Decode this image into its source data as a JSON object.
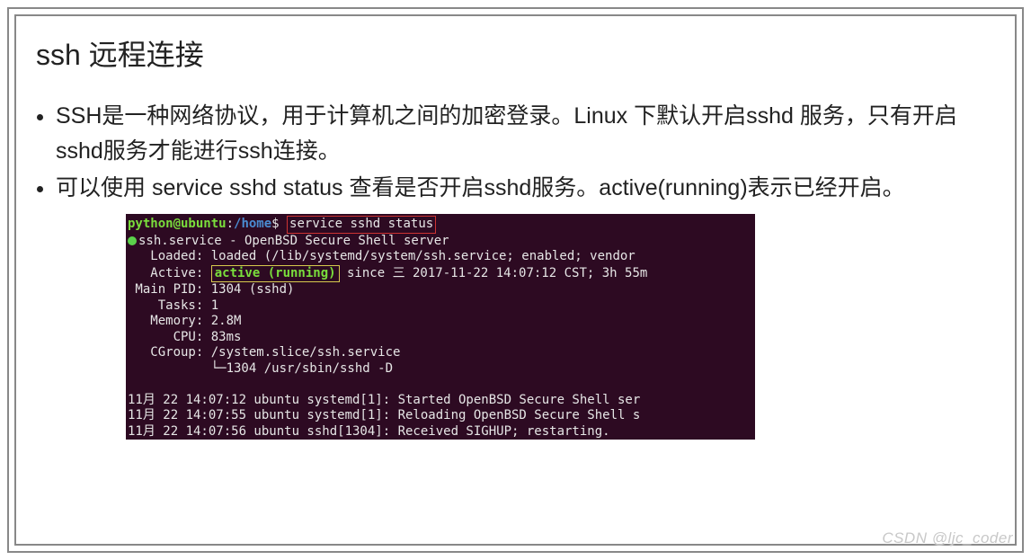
{
  "title": "ssh 远程连接",
  "bullets": [
    "SSH是一种网络协议，用于计算机之间的加密登录。Linux 下默认开启sshd 服务，只有开启sshd服务才能进行ssh连接。",
    "可以使用 service sshd status 查看是否开启sshd服务。active(running)表示已经开启。"
  ],
  "terminal": {
    "prompt_user": "python@ubuntu",
    "prompt_sep": ":",
    "prompt_path": "/home",
    "prompt_end": "$ ",
    "command": "service sshd status",
    "service_line": "ssh.service - OpenBSD Secure Shell server",
    "loaded": "   Loaded: loaded (/lib/systemd/system/ssh.service; enabled; vendor",
    "active_prefix": "   Active: ",
    "active_status": "active (running)",
    "active_suffix": " since 三 2017-11-22 14:07:12 CST; 3h 55m",
    "mainpid": " Main PID: 1304 (sshd)",
    "tasks": "    Tasks: 1",
    "memory": "   Memory: 2.8M",
    "cpu": "      CPU: 83ms",
    "cgroup": "   CGroup: /system.slice/ssh.service",
    "cgroup2": "           └─1304 /usr/sbin/sshd -D",
    "blank": " ",
    "log1": "11月 22 14:07:12 ubuntu systemd[1]: Started OpenBSD Secure Shell ser",
    "log2": "11月 22 14:07:55 ubuntu systemd[1]: Reloading OpenBSD Secure Shell s",
    "log3": "11月 22 14:07:56 ubuntu sshd[1304]: Received SIGHUP; restarting."
  },
  "watermark": "CSDN @ljc_coder"
}
